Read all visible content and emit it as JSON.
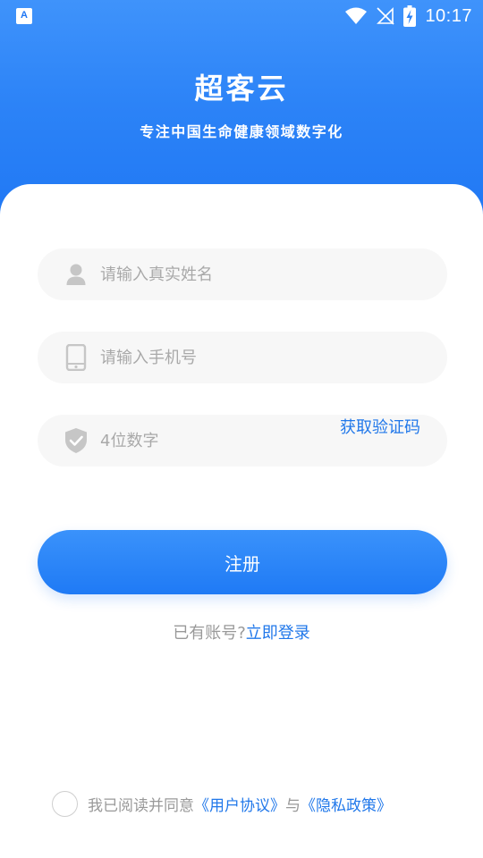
{
  "status_bar": {
    "time": "10:17",
    "app_icon_letter": "A",
    "icons": [
      "app-notification-icon",
      "wifi-icon",
      "signal-icon",
      "battery-icon"
    ]
  },
  "brand": {
    "title": "超客云",
    "slogan": "专注中国生命健康领域数字化"
  },
  "form": {
    "name_placeholder": "请输入真实姓名",
    "phone_placeholder": "请输入手机号",
    "code_placeholder": "4位数字",
    "get_code_label": "获取验证码",
    "register_label": "注册",
    "field_icons": [
      "user-icon",
      "phone-icon",
      "shield-check-icon"
    ]
  },
  "login_prompt": {
    "text": "已有账号?",
    "link": "立即登录"
  },
  "agreement": {
    "prefix": "我已阅读并同意",
    "user_agreement": "《用户协议》",
    "connector": "与",
    "privacy_policy": "《隐私政策》"
  },
  "colors": {
    "primary": "#1f77f4",
    "link": "#2178ea",
    "field_bg": "#f7f7f7",
    "placeholder": "#a9a9a9",
    "muted_text": "#999999"
  }
}
